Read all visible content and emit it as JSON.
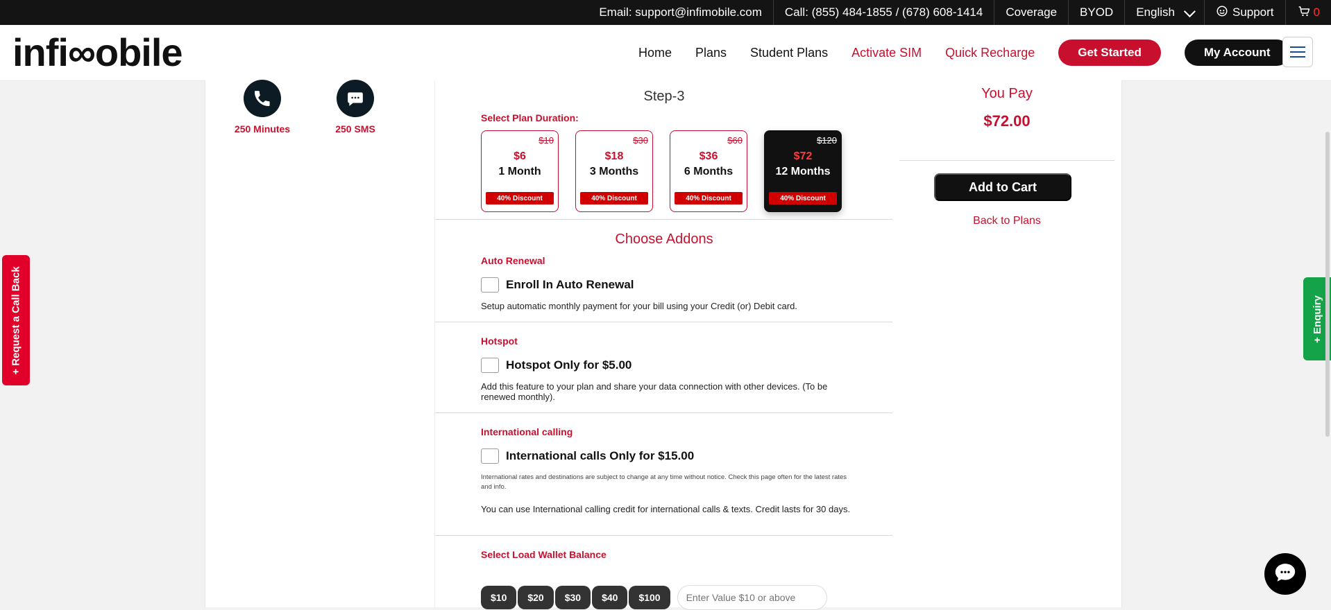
{
  "topbar": {
    "email": "Email: support@infimobile.com",
    "call": "Call: (855) 484-1855 / (678) 608-1414",
    "coverage": "Coverage",
    "byod": "BYOD",
    "language": "English",
    "support": "Support",
    "cart_count": "0"
  },
  "header": {
    "logo_text": "infi∞obile",
    "nav": [
      "Home",
      "Plans",
      "Student Plans",
      "Activate SIM",
      "Quick Recharge"
    ],
    "get_started": "Get Started",
    "my_account": "My Account"
  },
  "features": [
    {
      "label": "250 Minutes"
    },
    {
      "label": "250 SMS"
    }
  ],
  "step": {
    "title": "Step-3",
    "select_duration": "Select Plan Duration:",
    "plans": [
      {
        "old": "$10",
        "price": "$6",
        "months": "1 Month",
        "discount": "40% Discount"
      },
      {
        "old": "$30",
        "price": "$18",
        "months": "3 Months",
        "discount": "40% Discount"
      },
      {
        "old": "$60",
        "price": "$36",
        "months": "6 Months",
        "discount": "40% Discount"
      },
      {
        "old": "$120",
        "price": "$72",
        "months": "12 Months",
        "discount": "40% Discount"
      }
    ]
  },
  "addons": {
    "title": "Choose Addons",
    "auto_renewal": {
      "label": "Auto Renewal",
      "option": "Enroll In Auto Renewal",
      "desc": "Setup automatic monthly payment for your bill using your Credit (or) Debit card."
    },
    "hotspot": {
      "label": "Hotspot",
      "option": "Hotspot Only for $5.00",
      "desc": "Add this feature to your plan and share your data connection with other devices. (To be renewed monthly)."
    },
    "international": {
      "label": "International calling",
      "option": "International calls Only for $15.00",
      "small": "International rates and destinations are subject to change at any time without notice. Check this page often for the latest rates and info.",
      "desc": "You can use International calling credit for international calls & texts. Credit lasts for 30 days."
    },
    "wallet": {
      "label": "Select Load Wallet Balance",
      "amounts": [
        "$10",
        "$20",
        "$30",
        "$40",
        "$100"
      ],
      "placeholder": "Enter Value $10 or above"
    }
  },
  "summary": {
    "you_pay": "You Pay",
    "amount": "$72.00",
    "add_to_cart": "Add to Cart",
    "back_to_plans": "Back to Plans"
  },
  "side": {
    "request_call": "+ Request a Call Back",
    "enquiry": "+ Enquiry"
  }
}
